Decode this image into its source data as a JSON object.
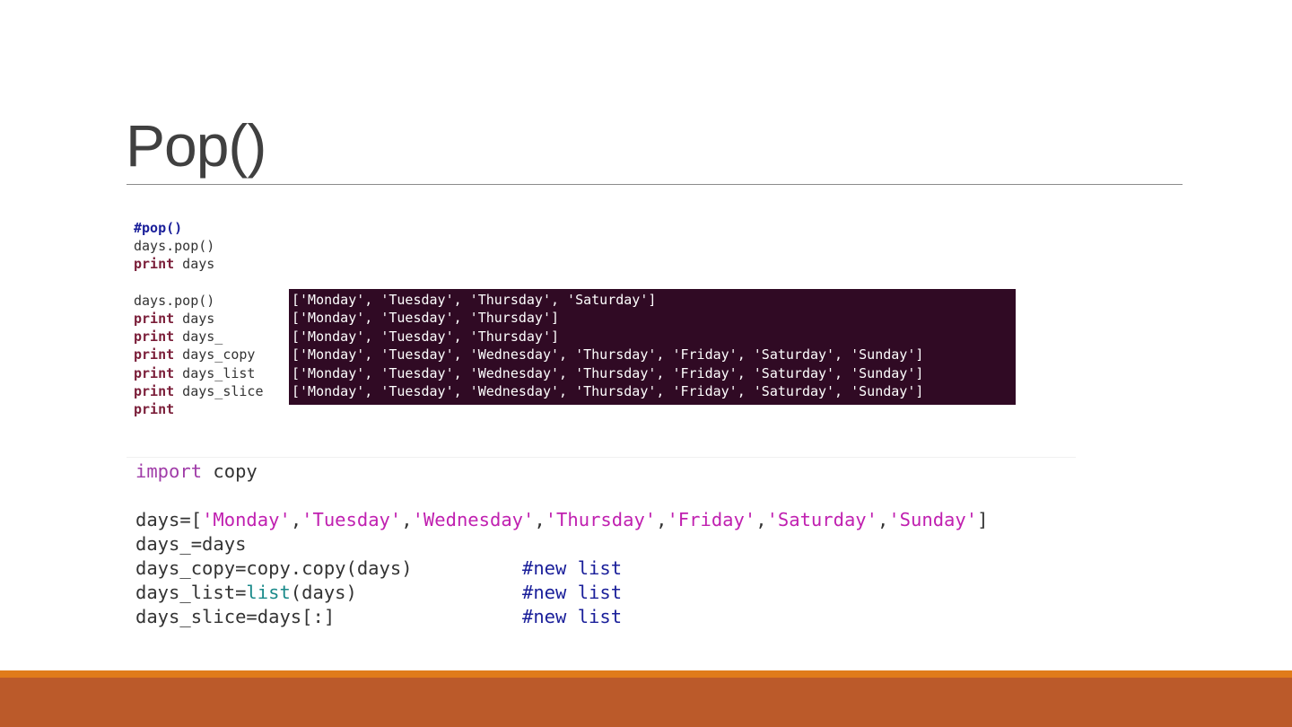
{
  "slide": {
    "title": "Pop()"
  },
  "code_top": {
    "lines1": [
      {
        "comment": "#pop()"
      },
      {
        "text": "days.pop()"
      },
      {
        "kw": "print",
        "text": " days"
      }
    ],
    "lines2": [
      {
        "text": "days.pop()"
      },
      {
        "kw": "print",
        "text": " days"
      },
      {
        "kw": "print",
        "text": " days_"
      },
      {
        "kw": "print",
        "text": " days_copy"
      },
      {
        "kw": "print",
        "text": " days_list"
      },
      {
        "kw": "print",
        "text": " days_slice"
      },
      {
        "kw": "print",
        "text": ""
      }
    ]
  },
  "terminal": {
    "background": "#300a24",
    "lines": [
      "['Monday', 'Tuesday', 'Thursday', 'Saturday']",
      "['Monday', 'Tuesday', 'Thursday']",
      "['Monday', 'Tuesday', 'Thursday']",
      "['Monday', 'Tuesday', 'Wednesday', 'Thursday', 'Friday', 'Saturday', 'Sunday']",
      "['Monday', 'Tuesday', 'Wednesday', 'Thursday', 'Friday', 'Saturday', 'Sunday']",
      "['Monday', 'Tuesday', 'Wednesday', 'Thursday', 'Friday', 'Saturday', 'Sunday']"
    ]
  },
  "code_bottom": {
    "import_kw": "import",
    "import_mod": " copy",
    "days_prefix": "days=[",
    "days_items": [
      "'Monday'",
      "'Tuesday'",
      "'Wednesday'",
      "'Thursday'",
      "'Friday'",
      "'Saturday'",
      "'Sunday'"
    ],
    "days_suffix": "]",
    "alias_line": "days_=days",
    "copy_line": "days_copy=copy.copy(days)",
    "list_line_prefix": "days_list=",
    "list_builtin": "list",
    "list_line_suffix": "(days)",
    "slice_line": "days_slice=days[:]",
    "comment_new": "#new list"
  },
  "colors": {
    "footer_accent": "#e07b1a",
    "footer_bar": "#bb5a2a"
  }
}
